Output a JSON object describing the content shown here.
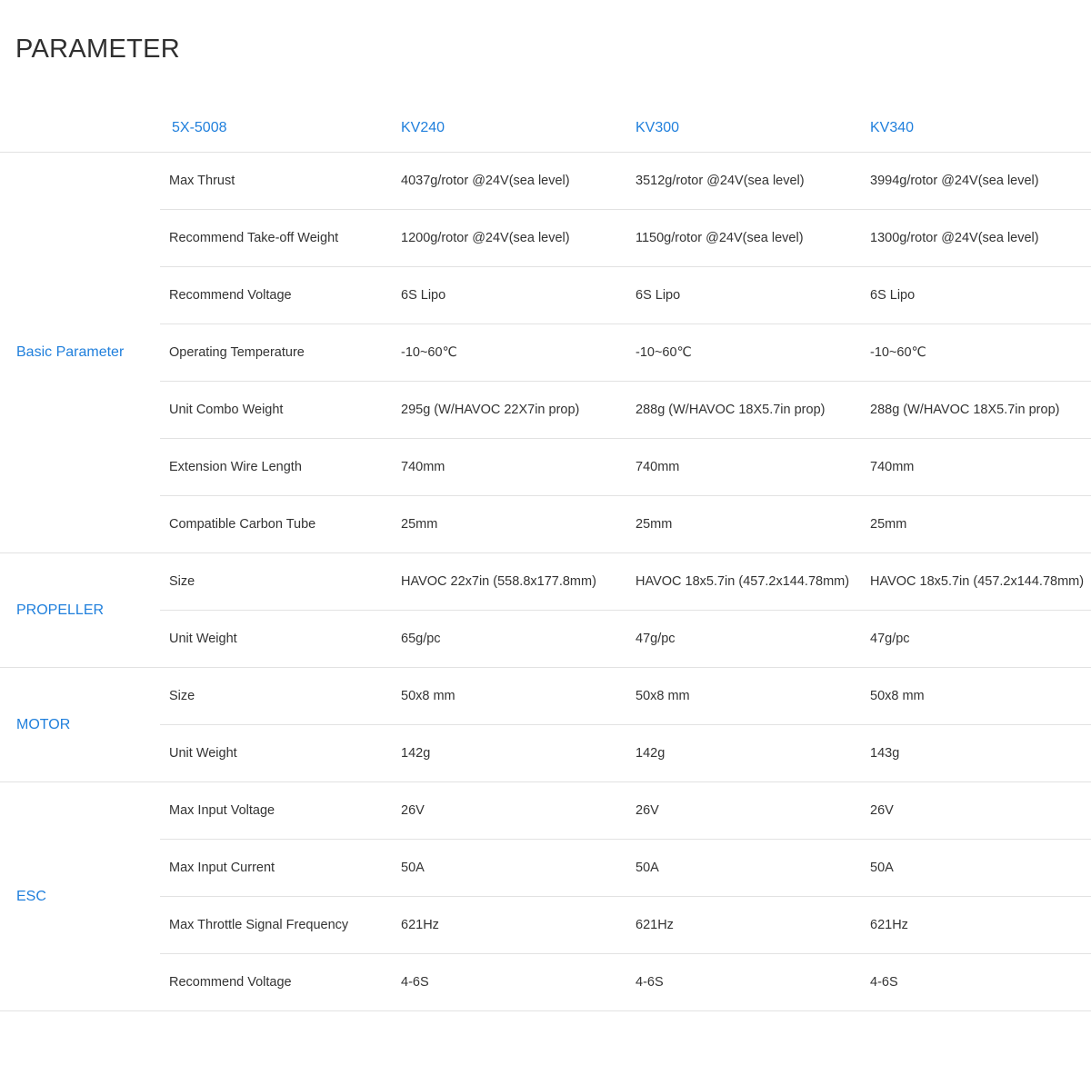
{
  "page": {
    "title": "PARAMETER"
  },
  "header": {
    "model": "5X-5008",
    "variants": [
      "KV240",
      "KV300",
      "KV340"
    ]
  },
  "sections": [
    {
      "label": "Basic Parameter",
      "rows": [
        {
          "name": "Max Thrust",
          "values": [
            "4037g/rotor @24V(sea level)",
            "3512g/rotor @24V(sea level)",
            "3994g/rotor @24V(sea level)"
          ]
        },
        {
          "name": "Recommend Take-off Weight",
          "values": [
            "1200g/rotor @24V(sea level)",
            "1150g/rotor @24V(sea level)",
            "1300g/rotor @24V(sea level)"
          ]
        },
        {
          "name": "Recommend Voltage",
          "values": [
            "6S Lipo",
            "6S Lipo",
            "6S Lipo"
          ]
        },
        {
          "name": "Operating Temperature",
          "values": [
            "-10~60℃",
            "-10~60℃",
            "-10~60℃"
          ]
        },
        {
          "name": "Unit Combo Weight",
          "values": [
            "295g (W/HAVOC 22X7in prop)",
            "288g (W/HAVOC 18X5.7in prop)",
            "288g  (W/HAVOC 18X5.7in prop)"
          ]
        },
        {
          "name": "Extension Wire Length",
          "values": [
            "740mm",
            "740mm",
            "740mm"
          ]
        },
        {
          "name": "Compatible Carbon Tube",
          "values": [
            "25mm",
            "25mm",
            "25mm"
          ]
        }
      ]
    },
    {
      "label": "PROPELLER",
      "rows": [
        {
          "name": "Size",
          "values": [
            "HAVOC 22x7in (558.8x177.8mm)",
            "HAVOC 18x5.7in (457.2x144.78mm)",
            "HAVOC 18x5.7in (457.2x144.78mm)"
          ]
        },
        {
          "name": "Unit Weight",
          "values": [
            "65g/pc",
            "47g/pc",
            "47g/pc"
          ]
        }
      ]
    },
    {
      "label": "MOTOR",
      "rows": [
        {
          "name": "Size",
          "values": [
            "50x8 mm",
            "50x8 mm",
            "50x8 mm"
          ]
        },
        {
          "name": "Unit Weight",
          "values": [
            "142g",
            "142g",
            "143g"
          ]
        }
      ]
    },
    {
      "label": "ESC",
      "rows": [
        {
          "name": "Max Input Voltage",
          "values": [
            "26V",
            "26V",
            "26V"
          ]
        },
        {
          "name": "Max Input Current",
          "values": [
            "50A",
            "50A",
            "50A"
          ]
        },
        {
          "name": "Max Throttle Signal Frequency",
          "values": [
            "621Hz",
            "621Hz",
            "621Hz"
          ]
        },
        {
          "name": "Recommend Voltage",
          "values": [
            "4-6S",
            "4-6S",
            "4-6S"
          ]
        }
      ]
    }
  ]
}
